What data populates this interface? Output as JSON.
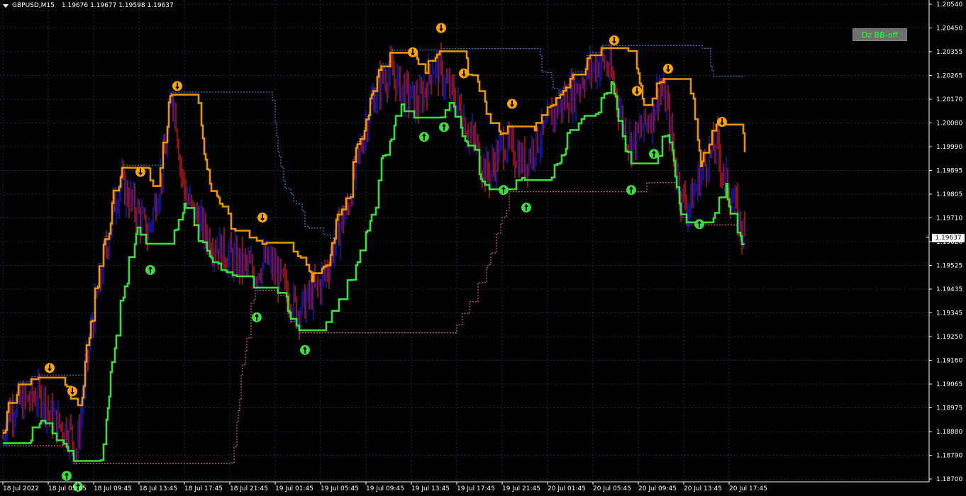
{
  "header": {
    "symbol": "GBPUSD,M15",
    "open": "1.19676",
    "high": "1.19677",
    "low": "1.19598",
    "close": "1.19637"
  },
  "indicator_button": {
    "label": "Dz BB-off"
  },
  "current_price": "1.19637",
  "colors": {
    "background": "#000000",
    "up_candle": "#1f1fe6",
    "down_candle": "#e61f1f",
    "support_line": "#3ddc3d",
    "resistance_line": "#ffa500",
    "upper_band": "#3aa3ff",
    "lower_band": "#ff7f7f",
    "grid": "#1c2a44"
  },
  "chart_data": {
    "type": "line",
    "title": "GBPUSD,M15",
    "y_axis_ticks": [
      "1.20540",
      "1.20450",
      "1.20355",
      "1.20265",
      "1.20170",
      "1.20080",
      "1.19990",
      "1.19895",
      "1.19805",
      "1.19710",
      "1.19620",
      "1.19525",
      "1.19435",
      "1.19345",
      "1.19250",
      "1.19160",
      "1.19065",
      "1.18975",
      "1.18880",
      "1.18790",
      "1.18700"
    ],
    "x_axis_ticks": [
      "18 Jul 2022",
      "18 Jul 05:45",
      "18 Jul 09:45",
      "18 Jul 13:45",
      "18 Jul 17:45",
      "18 Jul 21:45",
      "19 Jul 01:45",
      "19 Jul 05:45",
      "19 Jul 09:45",
      "19 Jul 13:45",
      "19 Jul 17:45",
      "19 Jul 21:45",
      "20 Jul 01:45",
      "20 Jul 05:45",
      "20 Jul 09:45",
      "20 Jul 13:45",
      "20 Jul 17:45"
    ],
    "ylim": [
      1.187,
      1.2054
    ],
    "price_path": [
      [
        0,
        1.188
      ],
      [
        10,
        1.1895
      ],
      [
        20,
        1.1898
      ],
      [
        35,
        1.19
      ],
      [
        50,
        1.1902
      ],
      [
        62,
        1.1901
      ],
      [
        70,
        1.1895
      ],
      [
        80,
        1.1892
      ],
      [
        90,
        1.189
      ],
      [
        100,
        1.1888
      ],
      [
        108,
        1.188
      ],
      [
        112,
        1.189
      ],
      [
        120,
        1.191
      ],
      [
        130,
        1.193
      ],
      [
        140,
        1.1945
      ],
      [
        150,
        1.196
      ],
      [
        160,
        1.1975
      ],
      [
        170,
        1.1985
      ],
      [
        180,
        1.198
      ],
      [
        190,
        1.1975
      ],
      [
        200,
        1.197
      ],
      [
        208,
        1.1965
      ],
      [
        215,
        1.1972
      ],
      [
        225,
        1.1985
      ],
      [
        235,
        1.2
      ],
      [
        242,
        1.202
      ],
      [
        248,
        1.201
      ],
      [
        255,
        1.199
      ],
      [
        262,
        1.198
      ],
      [
        270,
        1.1975
      ],
      [
        280,
        1.197
      ],
      [
        290,
        1.1965
      ],
      [
        300,
        1.1962
      ],
      [
        315,
        1.1958
      ],
      [
        330,
        1.1955
      ],
      [
        345,
        1.1953
      ],
      [
        360,
        1.195
      ],
      [
        375,
        1.1955
      ],
      [
        390,
        1.195
      ],
      [
        400,
        1.1945
      ],
      [
        410,
        1.194
      ],
      [
        420,
        1.1935
      ],
      [
        430,
        1.1938
      ],
      [
        440,
        1.1942
      ],
      [
        450,
        1.1945
      ],
      [
        460,
        1.195
      ],
      [
        470,
        1.196
      ],
      [
        480,
        1.1968
      ],
      [
        490,
        1.1975
      ],
      [
        500,
        1.1988
      ],
      [
        510,
        1.2
      ],
      [
        520,
        1.2012
      ],
      [
        530,
        1.202
      ],
      [
        540,
        1.2025
      ],
      [
        550,
        1.2028
      ],
      [
        560,
        1.2024
      ],
      [
        570,
        1.202
      ],
      [
        580,
        1.2018
      ],
      [
        590,
        1.2015
      ],
      [
        600,
        1.2022
      ],
      [
        610,
        1.203
      ],
      [
        620,
        1.2028
      ],
      [
        630,
        1.2022
      ],
      [
        640,
        1.2018
      ],
      [
        650,
        1.2012
      ],
      [
        660,
        1.2005
      ],
      [
        670,
        1.2
      ],
      [
        680,
        1.1992
      ],
      [
        690,
        1.1988
      ],
      [
        700,
        1.1995
      ],
      [
        710,
        1.2
      ],
      [
        720,
        1.1998
      ],
      [
        730,
        1.1995
      ],
      [
        740,
        1.1992
      ],
      [
        750,
        1.1998
      ],
      [
        760,
        1.2002
      ],
      [
        770,
        1.2005
      ],
      [
        780,
        1.2012
      ],
      [
        790,
        1.2015
      ],
      [
        800,
        1.2018
      ],
      [
        810,
        1.202
      ],
      [
        820,
        1.2025
      ],
      [
        830,
        1.2028
      ],
      [
        840,
        1.203
      ],
      [
        850,
        1.2032
      ],
      [
        860,
        1.2028
      ],
      [
        870,
        1.2018
      ],
      [
        880,
        1.2005
      ],
      [
        890,
        1.2
      ],
      [
        900,
        1.2003
      ],
      [
        910,
        1.2008
      ],
      [
        920,
        1.2012
      ],
      [
        930,
        1.2022
      ],
      [
        940,
        1.2015
      ],
      [
        950,
        1.1995
      ],
      [
        960,
        1.198
      ],
      [
        970,
        1.1975
      ],
      [
        980,
        1.1982
      ],
      [
        990,
        1.199
      ],
      [
        1000,
        1.1995
      ],
      [
        1010,
        1.2
      ],
      [
        1020,
        1.1988
      ],
      [
        1030,
        1.198
      ],
      [
        1040,
        1.1972
      ],
      [
        1050,
        1.1963
      ]
    ]
  }
}
